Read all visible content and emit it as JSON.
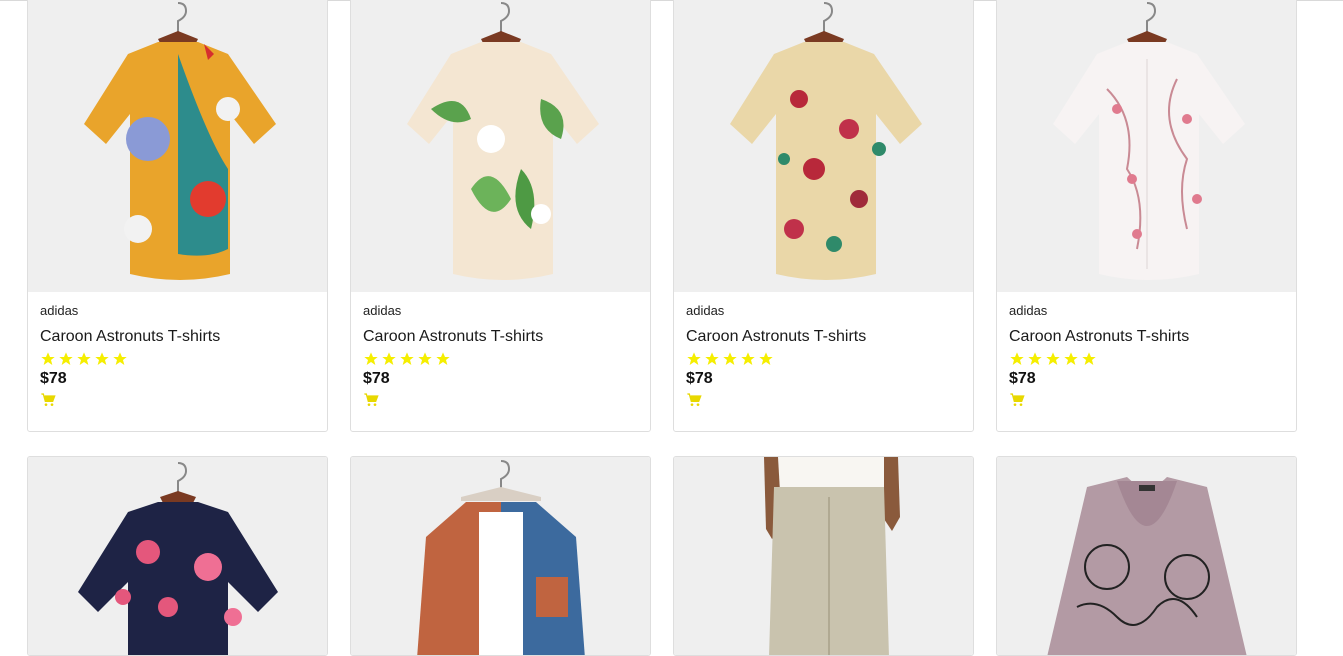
{
  "colors": {
    "star": "#f5ee00",
    "cart": "#e8d800",
    "tile_bg": "#efefef"
  },
  "products_row1": [
    {
      "brand": "adidas",
      "name": "Caroon Astronuts T-shirts",
      "rating": 5,
      "price": "$78",
      "cart_icon": "cart-icon"
    },
    {
      "brand": "adidas",
      "name": "Caroon Astronuts T-shirts",
      "rating": 5,
      "price": "$78",
      "cart_icon": "cart-icon"
    },
    {
      "brand": "adidas",
      "name": "Caroon Astronuts T-shirts",
      "rating": 5,
      "price": "$78",
      "cart_icon": "cart-icon"
    },
    {
      "brand": "adidas",
      "name": "Caroon Astronuts T-shirts",
      "rating": 5,
      "price": "$78",
      "cart_icon": "cart-icon"
    }
  ],
  "products_row2": [
    {
      "image": "navy-floral-shirt"
    },
    {
      "image": "corduroy-jacket"
    },
    {
      "image": "linen-trousers"
    },
    {
      "image": "pink-printed-blouse"
    }
  ]
}
